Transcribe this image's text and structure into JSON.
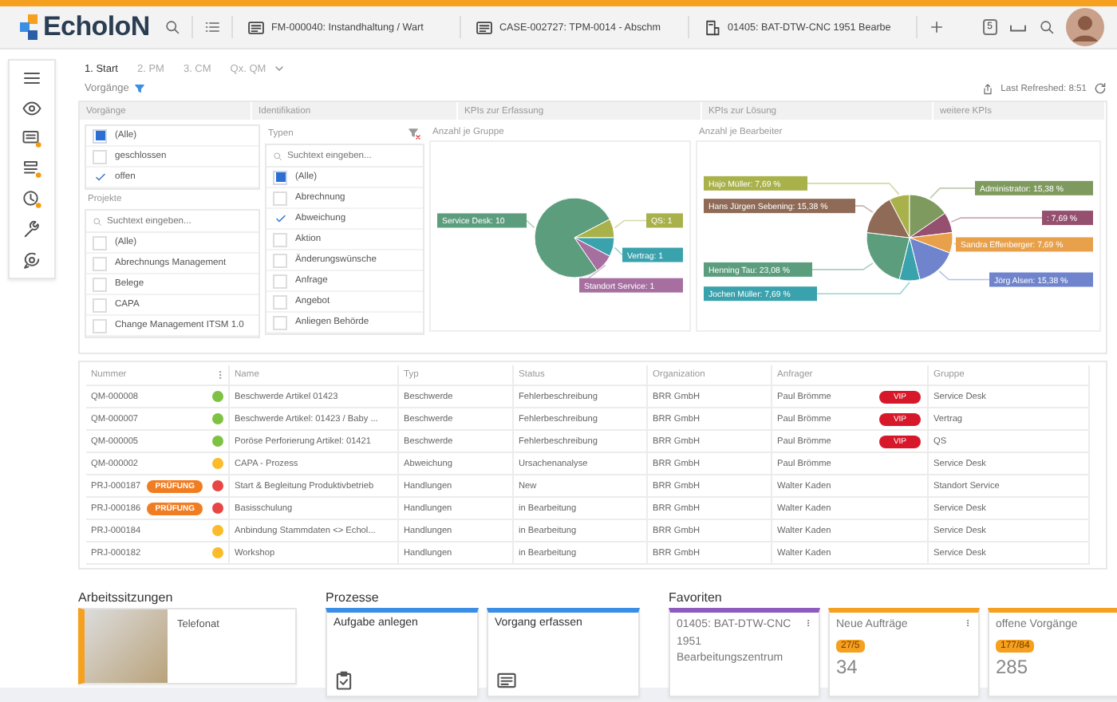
{
  "header": {
    "logo": "EcholoN",
    "tabs": [
      {
        "label": "FM-000040: Instandhaltung / Wart",
        "kind": "card"
      },
      {
        "label": "CASE-002727: TPM-0014 - Abschm",
        "kind": "card"
      },
      {
        "label": "01405: BAT-DTW-CNC 1951 Bearbe",
        "kind": "machine"
      }
    ],
    "notification_count": "5"
  },
  "page_tabs": [
    {
      "label": "1. Start",
      "selected": true
    },
    {
      "label": "2. PM",
      "selected": false
    },
    {
      "label": "3. CM",
      "selected": false
    },
    {
      "label": "Qx. QM",
      "selected": false
    }
  ],
  "section_title": "Vorgänge",
  "last_refreshed": "Last Refreshed: 8:51",
  "column_headers": [
    "Vorgänge",
    "Identifikation",
    "KPIs zur Erfassung",
    "KPIs zur Lösung",
    "weitere KPIs"
  ],
  "status_filter": {
    "items": [
      {
        "label": "(Alle)",
        "checked": false,
        "indeterminate": true
      },
      {
        "label": "geschlossen",
        "checked": false,
        "indeterminate": false
      },
      {
        "label": "offen",
        "checked": true,
        "indeterminate": false
      }
    ]
  },
  "projects_filter": {
    "title": "Projekte",
    "placeholder": "Suchtext eingeben...",
    "items": [
      {
        "label": "(Alle)",
        "checked": false,
        "indeterminate": false
      },
      {
        "label": "Abrechnungs Management",
        "checked": false,
        "indeterminate": false
      },
      {
        "label": "Belege",
        "checked": false,
        "indeterminate": false
      },
      {
        "label": "CAPA",
        "checked": false,
        "indeterminate": false
      },
      {
        "label": "Change Management ITSM 1.0",
        "checked": false,
        "indeterminate": false
      }
    ]
  },
  "types_filter": {
    "title": "Typen",
    "placeholder": "Suchtext eingeben...",
    "items": [
      {
        "label": "(Alle)",
        "checked": false,
        "indeterminate": true
      },
      {
        "label": "Abrechnung",
        "checked": false,
        "indeterminate": false
      },
      {
        "label": "Abweichung",
        "checked": true,
        "indeterminate": false
      },
      {
        "label": "Aktion",
        "checked": false,
        "indeterminate": false
      },
      {
        "label": "Änderungswünsche",
        "checked": false,
        "indeterminate": false
      },
      {
        "label": "Anfrage",
        "checked": false,
        "indeterminate": false
      },
      {
        "label": "Angebot",
        "checked": false,
        "indeterminate": false
      },
      {
        "label": "Anliegen Behörde",
        "checked": false,
        "indeterminate": false
      }
    ]
  },
  "charts": [
    {
      "title": "Anzahl je Gruppe",
      "chart_data": {
        "type": "pie",
        "series": [
          {
            "values": [
              76.92,
              7.69,
              7.69,
              7.7
            ]
          }
        ],
        "colors": [
          "#5c9d7d",
          "#a9b14a",
          "#3aa2ad",
          "#a66fa0"
        ],
        "value_labels": [
          "Service Desk: 10",
          "QS: 1",
          "Vertrag: 1",
          "Standort Service: 1"
        ]
      }
    },
    {
      "title": "Anzahl je Bearbeiter",
      "chart_data": {
        "type": "pie",
        "series": [
          {
            "values": [
              7.69,
              15.38,
              7.69,
              7.69,
              15.38,
              7.69,
              23.08,
              15.38
            ]
          }
        ],
        "colors": [
          "#a9b14a",
          "#7e9a5e",
          "#955070",
          "#e8a04a",
          "#6f84cc",
          "#3aa2ad",
          "#5c9d7d",
          "#8f6b57"
        ],
        "value_labels": [
          "Hajo Müller: 7,69 %",
          "Administrator: 15,38 %",
          ": 7,69 %",
          "Sandra Effenberger: 7,69 %",
          "Jörg Alsen: 15,38 %",
          "Jochen Müller: 7,69 %",
          "Henning Tau: 23,08 %",
          "Hans Jürgen Sebening: 15,38 %"
        ]
      }
    }
  ],
  "table": {
    "columns": [
      "Nummer",
      "Name",
      "Typ",
      "Status",
      "Organization",
      "Anfrager",
      "Gruppe"
    ],
    "rows": [
      {
        "number": "QM-000008",
        "color": "#7dc242",
        "name": "Beschwerde Artikel 01423",
        "type": "Beschwerde",
        "status": "Fehlerbeschreibung",
        "organization": "BRR GmbH",
        "requester": "Paul Brömme",
        "tag": "VIP",
        "group": "Service Desk"
      },
      {
        "number": "QM-000007",
        "color": "#7dc242",
        "name": "Beschwerde Artikel: 01423 / Baby ...",
        "type": "Beschwerde",
        "status": "Fehlerbeschreibung",
        "organization": "BRR GmbH",
        "requester": "Paul Brömme",
        "tag": "VIP",
        "group": "Vertrag"
      },
      {
        "number": "QM-000005",
        "color": "#7dc242",
        "name": "Poröse Perforierung Artikel: 01421",
        "type": "Beschwerde",
        "status": "Fehlerbeschreibung",
        "organization": "BRR GmbH",
        "requester": "Paul Brömme",
        "tag": "VIP",
        "group": "QS"
      },
      {
        "number": "QM-000002",
        "color": "#fbbb2a",
        "name": "CAPA - Prozess",
        "type": "Abweichung",
        "status": "Ursachenanalyse",
        "organization": "BRR GmbH",
        "requester": "Paul Brömme",
        "group": "Service Desk"
      },
      {
        "number": "PRJ-000187",
        "badge": "PRÜFUNG",
        "color": "#e84545",
        "name": "Start & Begleitung Produktivbetrieb",
        "type": "Handlungen",
        "status": "New",
        "organization": "BRR GmbH",
        "requester": "Walter Kaden",
        "group": "Standort Service"
      },
      {
        "number": "PRJ-000186",
        "badge": "PRÜFUNG",
        "color": "#e84545",
        "name": "Basisschulung",
        "type": "Handlungen",
        "status": "in Bearbeitung",
        "organization": "BRR GmbH",
        "requester": "Walter Kaden",
        "group": "Service Desk"
      },
      {
        "number": "PRJ-000184",
        "color": "#fbbb2a",
        "name": "Anbindung Stammdaten <> Echol...",
        "type": "Handlungen",
        "status": "in Bearbeitung",
        "organization": "BRR GmbH",
        "requester": "Walter Kaden",
        "group": "Service Desk"
      },
      {
        "number": "PRJ-000182",
        "color": "#fbbb2a",
        "name": "Workshop",
        "type": "Handlungen",
        "status": "in Bearbeitung",
        "organization": "BRR GmbH",
        "requester": "Walter Kaden",
        "group": "Service Desk"
      }
    ]
  },
  "work_sessions": {
    "title": "Arbeitssitzungen",
    "items": [
      {
        "label": "Telefonat",
        "color": "#f5a01e"
      }
    ]
  },
  "processes": {
    "title": "Prozesse",
    "items": [
      {
        "label": "Aufgabe anlegen",
        "kind": "clipboard",
        "color": "#3a8ee6"
      },
      {
        "label": "Vorgang erfassen",
        "kind": "card",
        "color": "#3a8ee6"
      }
    ]
  },
  "favorites": {
    "title": "Favoriten",
    "items": [
      {
        "label": "01405: BAT-DTW-CNC 1951 Bearbeitungszentrum",
        "color": "#8e5bbf"
      },
      {
        "label": "Neue Aufträge",
        "color": "#f5a01e",
        "badge": "27/5",
        "count": "34"
      },
      {
        "label": "offene Vorgänge",
        "color": "#f5a01e",
        "badge": "177/84",
        "count": "285"
      }
    ]
  }
}
